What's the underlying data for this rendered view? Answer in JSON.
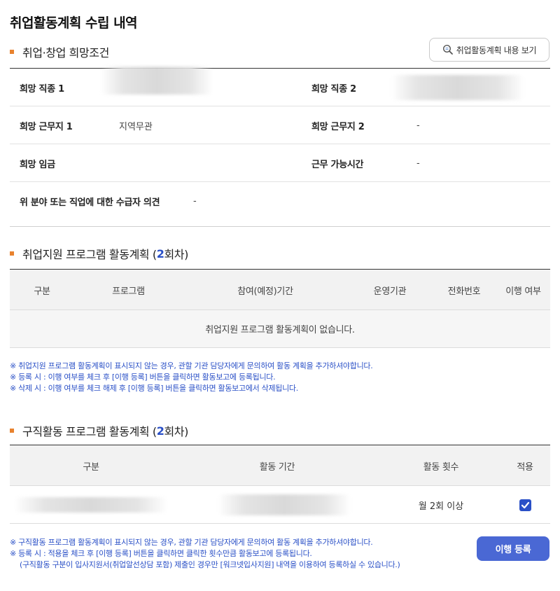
{
  "page": {
    "title": "취업활동계획 수립 내역"
  },
  "hope": {
    "section_title": "취업·창업 희망조건",
    "view_button": "취업활동계획 내용 보기",
    "rows": [
      {
        "label_left": "희망 직종 1",
        "value_left": "",
        "label_right": "희망 직종 2",
        "value_right": ""
      },
      {
        "label_left": "희망 근무지 1",
        "value_left": "지역무관",
        "label_right": "희망 근무지 2",
        "value_right": "-"
      },
      {
        "label_left": "희망 임금",
        "value_left": "",
        "label_right": "근무 가능시간",
        "value_right": "-"
      }
    ],
    "opinion_label": "위 분야 또는 직업에 대한 수급자 의견",
    "opinion_value": "-"
  },
  "program": {
    "title_prefix": "취업지원 프로그램 활동계획 (",
    "round": "2",
    "title_suffix": "회차)",
    "columns": [
      "구분",
      "프로그램",
      "참여(예정)기간",
      "운영기관",
      "전화번호",
      "이행 여부"
    ],
    "empty_message": "취업지원 프로그램 활동계획이 없습니다.",
    "notes": [
      "※ 취업지원 프로그램 활동계획이 표시되지 않는 경우, 관할 기관 담당자에게 문의하여 활동 계획을 추가하셔야합니다.",
      "※ 등록 시 : 이행 여부를 체크 후 [이행 등록] 버튼을 클릭하면 활동보고에 등록됩니다.",
      "※ 삭제 시 : 이행 여부를 체크 해제 후 [이행 등록] 버튼을 클릭하면 활동보고에서 삭제됩니다."
    ]
  },
  "job_search": {
    "title_prefix": "구직활동 프로그램 활동계획 (",
    "round": "2",
    "title_suffix": "회차)",
    "columns": [
      "구분",
      "활동 기간",
      "활동 횟수",
      "적용"
    ],
    "rows": [
      {
        "type": "",
        "period": "",
        "count": "월 2회 이상",
        "applied": true
      }
    ],
    "notes": [
      "※ 구직활동 프로그램 활동계획이 표시되지 않는 경우, 관할 기관 담당자에게 문의하여 활동 계획을 추가하셔야합니다.",
      "※ 등록 시 : 적용을 체크 후 [이행 등록] 버튼을 클릭하면 클릭한 횟수만큼 활동보고에 등록됩니다.",
      "(구직활동 구분이 입사지원서(취업알선상담 포함) 제출인 경우만 [워크넷입사지원] 내역을 이용하여 등록하실 수 있습니다.)"
    ],
    "submit_button": "이행 등록"
  },
  "colors": {
    "accent": "#2a50c7",
    "bullet": "#e8822e",
    "button": "#4a68d4"
  },
  "icons": {
    "view": "search-document-icon",
    "check": "checkmark-icon"
  }
}
